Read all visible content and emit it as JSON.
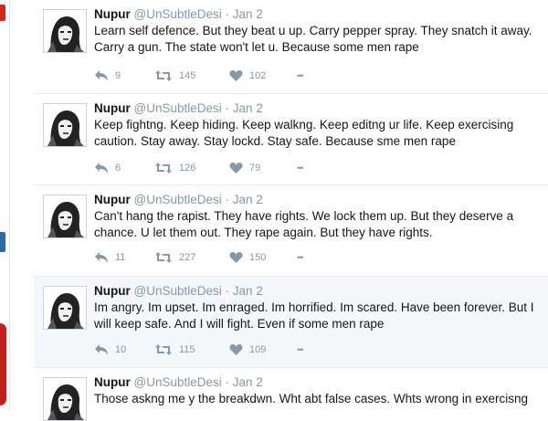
{
  "tweets": [
    {
      "name": "Nupur",
      "handle": "@UnSubtleDesi",
      "dot": "·",
      "date": "Jan 2",
      "text": "Learn self defence. But they beat u up. Carry pepper spray. They snatch it away. Carry a gun. The state won't let u. Because some men rape",
      "replies": "9",
      "retweets": "145",
      "likes": "102",
      "more": "•••"
    },
    {
      "name": "Nupur",
      "handle": "@UnSubtleDesi",
      "dot": "·",
      "date": "Jan 2",
      "text": "Keep fightng. Keep hiding. Keep walkng. Keep editng ur life. Keep exercising caution. Stay away. Stay lockd. Stay safe. Because sme men rape",
      "replies": "6",
      "retweets": "126",
      "likes": "79",
      "more": "•••"
    },
    {
      "name": "Nupur",
      "handle": "@UnSubtleDesi",
      "dot": "·",
      "date": "Jan 2",
      "text": "Can't hang the rapist. They have rights. We lock them up. But they deserve a chance. U let them out. They rape again. But they have rights.",
      "replies": "11",
      "retweets": "227",
      "likes": "150",
      "more": "•••"
    },
    {
      "name": "Nupur",
      "handle": "@UnSubtleDesi",
      "dot": "·",
      "date": "Jan 2",
      "text": "Im angry. Im upset. Im enraged. Im horrified. Im scared. Have been forever. But I will keep safe. And I will fight. Even if some men rape",
      "replies": "10",
      "retweets": "115",
      "likes": "109",
      "more": "•••"
    },
    {
      "name": "Nupur",
      "handle": "@UnSubtleDesi",
      "dot": "·",
      "date": "Jan 2",
      "text": "Those askng me y the breakdwn. Wht abt false cases. Whts wrong in exercisng",
      "replies": "",
      "retweets": "",
      "likes": "",
      "more": ""
    }
  ],
  "icons": {
    "reply": "reply-icon",
    "retweet": "retweet-icon",
    "like": "heart-icon",
    "more": "more-icon"
  },
  "colors": {
    "thread_line": "#f2a3ad",
    "muted": "#8899a6",
    "highlight_bg": "#f5f8fa"
  }
}
